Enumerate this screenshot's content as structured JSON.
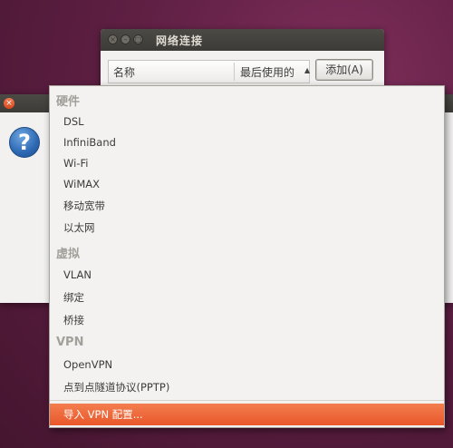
{
  "network_window": {
    "title": "网络连接",
    "column_name": "名称",
    "column_last_used": "最后使用的",
    "add_button": "添加(A)"
  },
  "dialog": {
    "close_glyph": "×",
    "icon_glyph": "?"
  },
  "menu": {
    "hardware_header": "硬件",
    "hardware_items": [
      "DSL",
      "InfiniBand",
      "Wi-Fi",
      "WiMAX",
      "移动宽带",
      "以太网"
    ],
    "virtual_header": "虚拟",
    "virtual_items": [
      "VLAN",
      "绑定",
      "桥接"
    ],
    "vpn_header": "VPN",
    "vpn_items": [
      "OpenVPN",
      "点到点隧道协议(PPTP)"
    ],
    "import_item": "导入 VPN 配置..."
  },
  "colors": {
    "highlight": "#e9572a",
    "desktop_bg": "#5e1f43"
  }
}
